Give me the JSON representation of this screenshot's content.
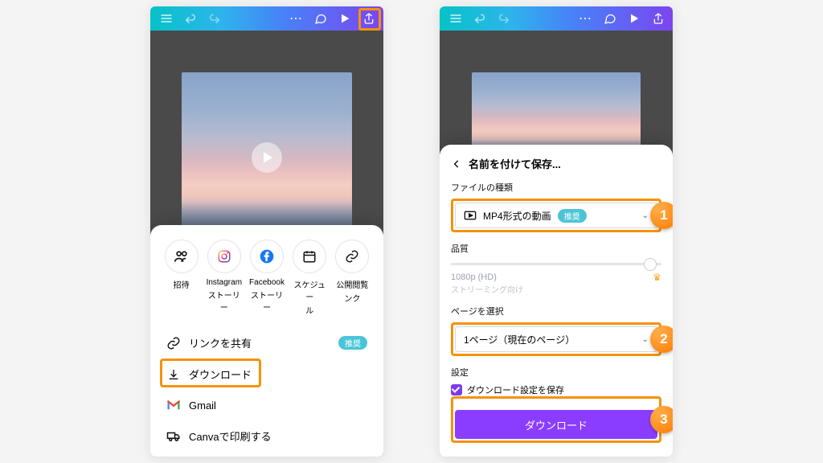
{
  "left": {
    "share_items": [
      {
        "label1": "招待",
        "label2": ""
      },
      {
        "label1": "Instagram",
        "label2": "ストーリー"
      },
      {
        "label1": "Facebook",
        "label2": "ストーリー"
      },
      {
        "label1": "スケジュー",
        "label2": "ル"
      },
      {
        "label1": "公開閲覧",
        "label2": "ンク"
      }
    ],
    "menu": {
      "share_link": "リンクを共有",
      "rec": "推奨",
      "download": "ダウンロード",
      "gmail": "Gmail",
      "print": "Canvaで印刷する"
    }
  },
  "right": {
    "title": "名前を付けて保存...",
    "file_type_label": "ファイルの種類",
    "file_type_value": "MP4形式の動画",
    "rec": "推奨",
    "quality_label": "品質",
    "quality_value": "1080p (HD)",
    "quality_sub": "ストリーミング向け",
    "pages_label": "ページを選択",
    "pages_value": "1ページ（現在のページ）",
    "settings_label": "設定",
    "save_settings": "ダウンロード設定を保存",
    "download_btn": "ダウンロード",
    "steps": {
      "1": "1",
      "2": "2",
      "3": "3"
    }
  }
}
